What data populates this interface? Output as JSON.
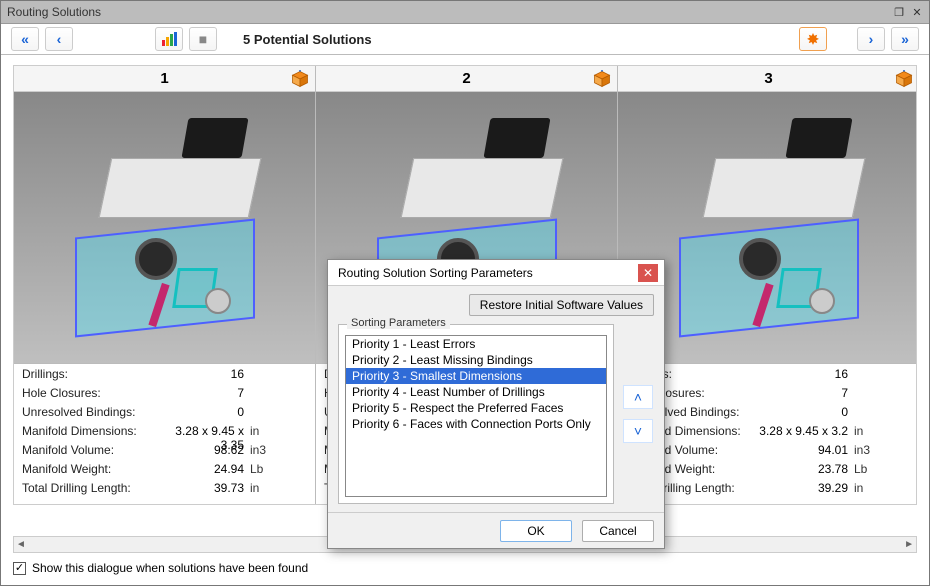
{
  "window": {
    "title": "Routing Solutions"
  },
  "toolbar": {
    "headline": "5 Potential Solutions"
  },
  "solutions": [
    {
      "number": "1",
      "stats": {
        "drillings_label": "Drillings:",
        "drillings_val": "16",
        "drillings_unit": "",
        "holes_label": "Hole Closures:",
        "holes_val": "7",
        "holes_unit": "",
        "unresolved_label": "Unresolved Bindings:",
        "unresolved_val": "0",
        "unresolved_unit": "",
        "dims_label": "Manifold Dimensions:",
        "dims_val": "3.28 x 9.45 x 3.35",
        "dims_unit": "in",
        "vol_label": "Manifold Volume:",
        "vol_val": "98.62",
        "vol_unit": "in3",
        "weight_label": "Manifold Weight:",
        "weight_val": "24.94",
        "weight_unit": "Lb",
        "len_label": "Total Drilling Length:",
        "len_val": "39.73",
        "len_unit": "in"
      }
    },
    {
      "number": "2",
      "stats": {
        "drillings_label": "Drillings:",
        "drillings_val": "",
        "drillings_unit": "",
        "holes_label": "Hole Closures:",
        "holes_val": "",
        "holes_unit": "",
        "unresolved_label": "Unresolved Bindings:",
        "unresolved_val": "",
        "unresolved_unit": "",
        "dims_label": "Manifold Dimensions:",
        "dims_val": "",
        "dims_unit": "",
        "vol_label": "Manifold Volume:",
        "vol_val": "",
        "vol_unit": "",
        "weight_label": "Manifold Weight:",
        "weight_val": "",
        "weight_unit": "",
        "len_label": "Total Drilling Length:",
        "len_val": "",
        "len_unit": ""
      }
    },
    {
      "number": "3",
      "stats": {
        "drillings_label": "Drillings:",
        "drillings_val": "16",
        "drillings_unit": "",
        "holes_label": "Hole Closures:",
        "holes_val": "7",
        "holes_unit": "",
        "unresolved_label": "Unresolved Bindings:",
        "unresolved_val": "0",
        "unresolved_unit": "",
        "dims_label": "Manifold Dimensions:",
        "dims_val": "3.28 x 9.45 x 3.2",
        "dims_unit": "in",
        "vol_label": "Manifold Volume:",
        "vol_val": "94.01",
        "vol_unit": "in3",
        "weight_label": "Manifold Weight:",
        "weight_val": "23.78",
        "weight_unit": "Lb",
        "len_label": "Total Drilling Length:",
        "len_val": "39.29",
        "len_unit": "in"
      }
    }
  ],
  "bottom": {
    "show_dialogue_label": "Show this dialogue when solutions have been found",
    "checked": true
  },
  "modal": {
    "title": "Routing Solution Sorting Parameters",
    "restore_label": "Restore Initial Software Values",
    "group_label": "Sorting Parameters",
    "items": [
      "Priority 1 - Least Errors",
      "Priority 2 - Least Missing Bindings",
      "Priority 3 - Smallest Dimensions",
      "Priority 4 - Least Number of Drillings",
      "Priority 5 - Respect the Preferred Faces",
      "Priority 6 - Faces with Connection Ports Only"
    ],
    "selected_index": 2,
    "ok_label": "OK",
    "cancel_label": "Cancel"
  }
}
